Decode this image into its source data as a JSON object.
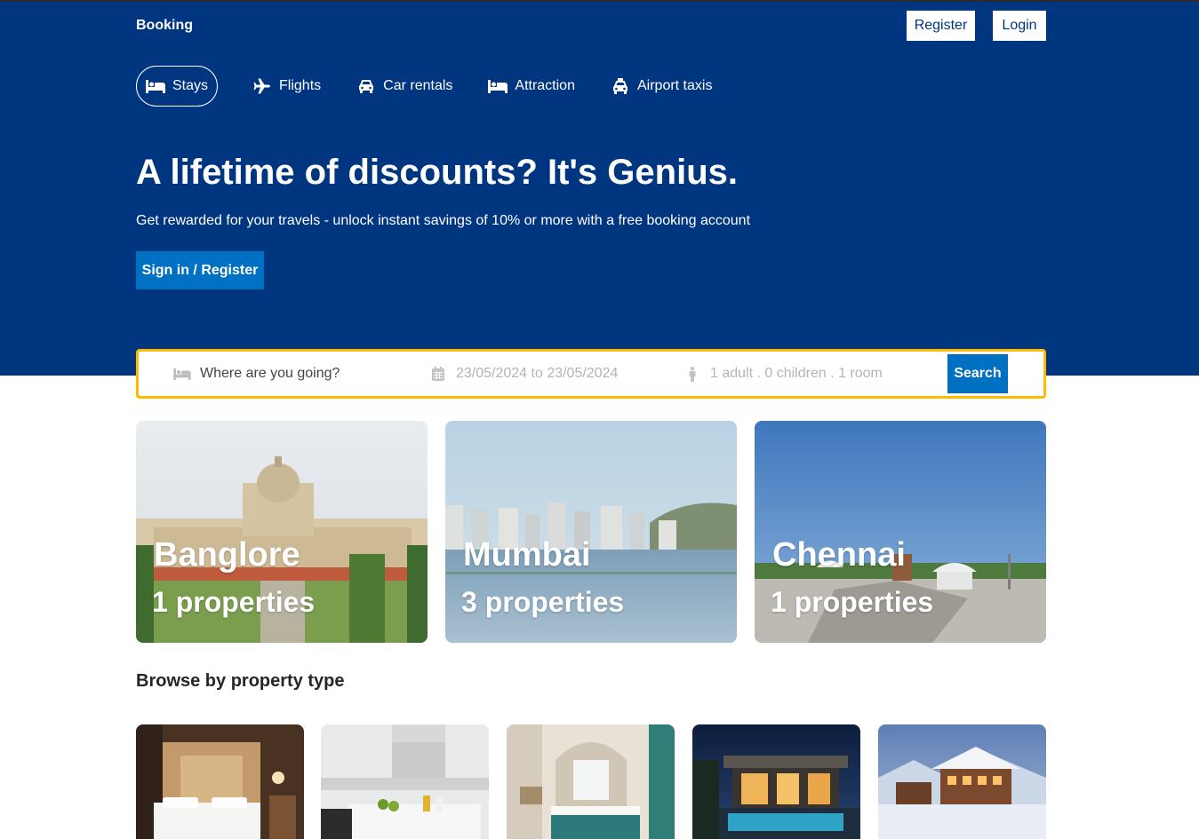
{
  "header": {
    "brand": "Booking",
    "register_label": "Register",
    "login_label": "Login"
  },
  "nav": {
    "tabs": [
      {
        "label": "Stays",
        "icon": "bed-icon",
        "active": true
      },
      {
        "label": "Flights",
        "icon": "plane-icon"
      },
      {
        "label": "Car rentals",
        "icon": "car-icon"
      },
      {
        "label": "Attraction",
        "icon": "bed-icon"
      },
      {
        "label": "Airport taxis",
        "icon": "taxi-icon"
      }
    ]
  },
  "hero": {
    "title": "A lifetime of discounts? It's Genius.",
    "subtitle": "Get rewarded for your travels - unlock instant savings of 10% or more with a free booking account",
    "cta_label": "Sign in / Register"
  },
  "search": {
    "destination_placeholder": "Where are you going?",
    "dates": "23/05/2024 to 23/05/2024",
    "guests": "1 adult . 0 children . 1 room",
    "button_label": "Search"
  },
  "featured": [
    {
      "city": "Banglore",
      "properties": "1 properties"
    },
    {
      "city": "Mumbai",
      "properties": "3 properties"
    },
    {
      "city": "Chennai",
      "properties": "1 properties"
    }
  ],
  "property_types": {
    "title": "Browse by property type"
  },
  "colors": {
    "brand_blue": "#003580",
    "action_blue": "#0071c2",
    "search_border": "#febb02"
  }
}
